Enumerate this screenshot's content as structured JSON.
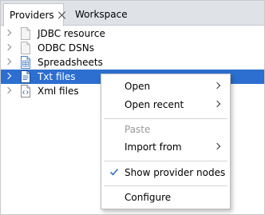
{
  "tabs": [
    {
      "label": "Providers",
      "active": true,
      "closable": true
    },
    {
      "label": "Workspace",
      "active": false,
      "closable": false
    }
  ],
  "tree": {
    "items": [
      {
        "label": "JDBC resource",
        "icon": "jdbc-file-icon",
        "selected": false
      },
      {
        "label": "ODBC DSNs",
        "icon": "odbc-file-icon",
        "selected": false
      },
      {
        "label": "Spreadsheets",
        "icon": "spreadsheet-icon",
        "selected": false
      },
      {
        "label": "Txt files",
        "icon": "txt-file-icon",
        "selected": true
      },
      {
        "label": "Xml files",
        "icon": "xml-file-icon",
        "selected": false
      }
    ]
  },
  "context_menu": {
    "items": [
      {
        "label": "Open",
        "submenu": true,
        "enabled": true
      },
      {
        "label": "Open recent",
        "submenu": true,
        "enabled": true
      },
      {
        "label": "Paste",
        "submenu": false,
        "enabled": false
      },
      {
        "label": "Import from",
        "submenu": true,
        "enabled": true
      },
      {
        "label": "Show provider nodes",
        "checked": true,
        "enabled": true
      },
      {
        "label": "Configure",
        "submenu": false,
        "enabled": true
      }
    ]
  },
  "colors": {
    "selection": "#2d6fd0",
    "tabbar": "#dfe3e8",
    "disabled_text": "#9a9a9a"
  }
}
